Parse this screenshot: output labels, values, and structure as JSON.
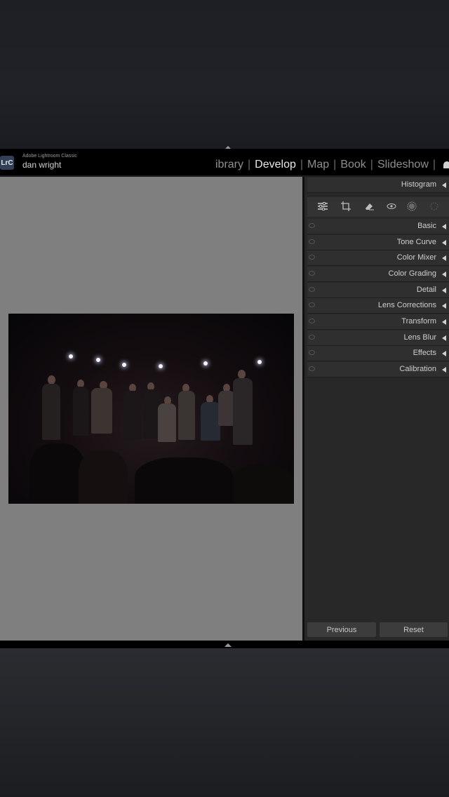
{
  "app": {
    "name": "Adobe Lightroom Classic",
    "logo_text": "LrC",
    "user": "dan wright"
  },
  "modules": [
    {
      "label": "ibrary",
      "active": false
    },
    {
      "label": "Develop",
      "active": true
    },
    {
      "label": "Map",
      "active": false
    },
    {
      "label": "Book",
      "active": false
    },
    {
      "label": "Slideshow",
      "active": false
    }
  ],
  "module_separator": "|",
  "panel": {
    "histogram": "Histogram",
    "tools": [
      "adjust-sliders-icon",
      "crop-icon",
      "healing-eraser-icon",
      "red-eye-icon",
      "masking-icon",
      "undo-circle-icon"
    ],
    "sections": [
      "Basic",
      "Tone Curve",
      "Color Mixer",
      "Color Grading",
      "Detail",
      "Lens Corrections",
      "Transform",
      "Lens Blur",
      "Effects",
      "Calibration"
    ]
  },
  "buttons": {
    "previous": "Previous",
    "reset": "Reset"
  },
  "colors": {
    "topbar": "#000000",
    "viewer_bg": "#7f7f7f",
    "panel_bg": "#282828",
    "active_module": "#e8e8e8"
  }
}
